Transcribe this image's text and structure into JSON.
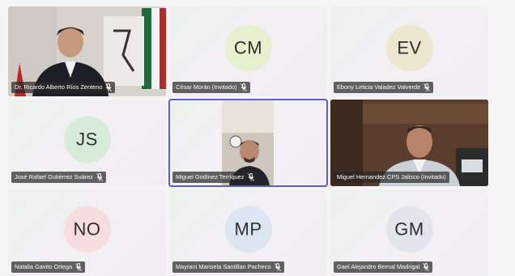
{
  "participants": [
    {
      "name": "Dr. Ricardo Alberto Ríos Zenteno",
      "initials": "",
      "avatar_color": "",
      "type": "video-office-flag"
    },
    {
      "name": "César Morán (Invitado)",
      "initials": "CM",
      "avatar_color": "#e6f0cf",
      "type": "avatar"
    },
    {
      "name": "Ebony Leticia Valadez Valverde",
      "initials": "EV",
      "avatar_color": "#efe6cf",
      "type": "avatar"
    },
    {
      "name": "José Rafael Gutiérrez Suárez",
      "initials": "JS",
      "avatar_color": "#d7ecd8",
      "type": "avatar"
    },
    {
      "name": "Miguel Godínez Terríquez",
      "initials": "",
      "avatar_color": "",
      "type": "video-home"
    },
    {
      "name": "Miguel Hernandez CPS Jalisco (Invitado)",
      "initials": "",
      "avatar_color": "",
      "type": "video-office"
    },
    {
      "name": "Natalia Gavito Ortega",
      "initials": "NO",
      "avatar_color": "#f6dede",
      "type": "avatar"
    },
    {
      "name": "Mayrani Marisela Santillan Pacheco",
      "initials": "MP",
      "avatar_color": "#dbe6f2",
      "type": "avatar"
    },
    {
      "name": "Gael Alejandro Bernal Madrigal",
      "initials": "GM",
      "avatar_color": "#e2e4ee",
      "type": "avatar"
    }
  ],
  "active_speaker_color": "#5b5fc7",
  "icons": {
    "mic": "mic-muted-icon"
  }
}
